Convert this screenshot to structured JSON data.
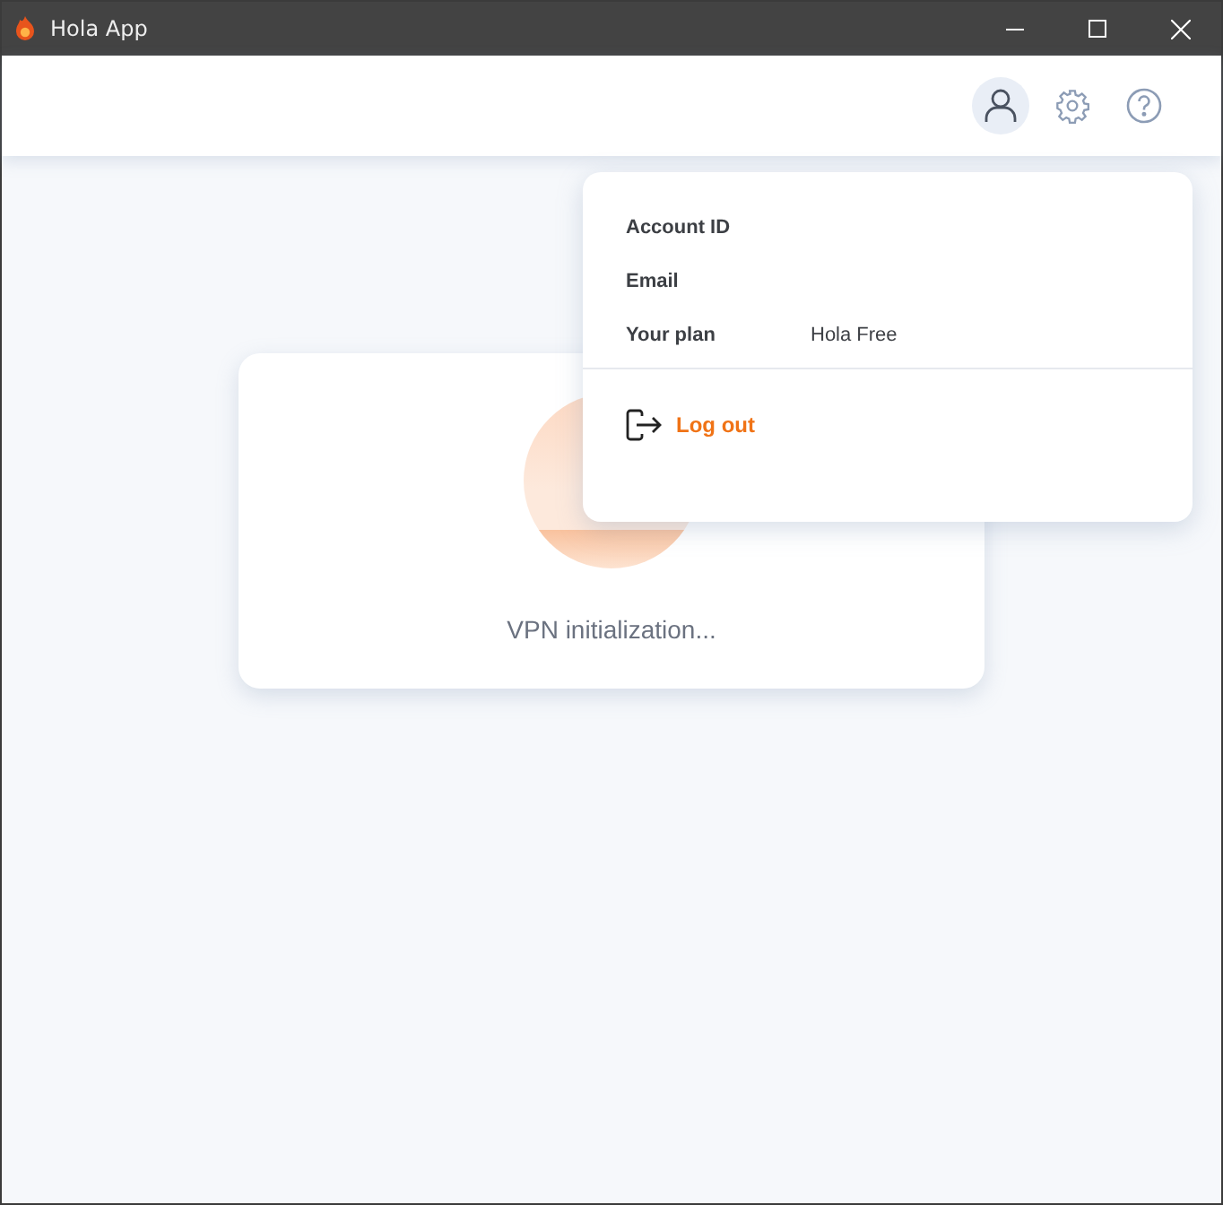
{
  "window": {
    "title": "Hola App"
  },
  "toolbar": [
    {
      "kind": "account",
      "selected": true
    },
    {
      "kind": "settings",
      "selected": false
    },
    {
      "kind": "help",
      "selected": false
    }
  ],
  "account_menu": {
    "rows": [
      {
        "label": "Account ID"
      },
      {
        "label": "Email"
      },
      {
        "label": "Your plan",
        "value": "Hola Free"
      }
    ],
    "logout": "Log out"
  },
  "status_card": {
    "message": "VPN initialization..."
  }
}
